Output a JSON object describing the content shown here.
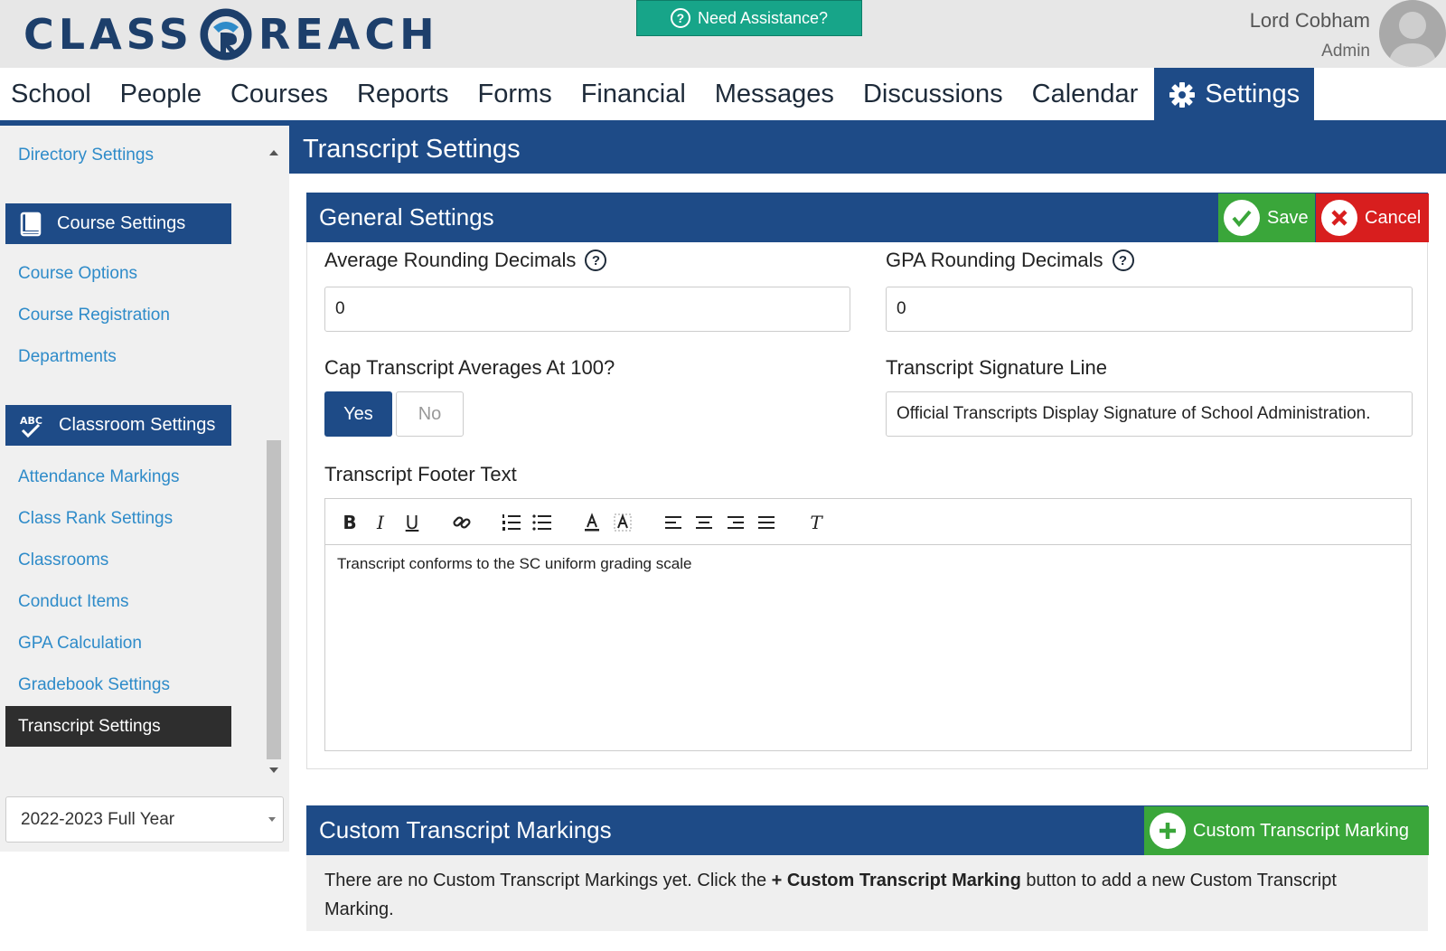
{
  "header": {
    "logo_left": "CLASS",
    "logo_right": "REACH",
    "help_button": "Need Assistance?",
    "user_name": "Lord Cobham",
    "user_role": "Admin"
  },
  "nav": {
    "items": [
      "School",
      "People",
      "Courses",
      "Reports",
      "Forms",
      "Financial",
      "Messages",
      "Discussions",
      "Calendar"
    ],
    "active": "Settings"
  },
  "sidebar": {
    "top_link": "Directory Settings",
    "course_heading": "Course Settings",
    "course_links": [
      "Course Options",
      "Course Registration",
      "Departments"
    ],
    "classroom_heading": "Classroom Settings",
    "classroom_links": [
      "Attendance Markings",
      "Class Rank Settings",
      "Classrooms",
      "Conduct Items",
      "GPA Calculation",
      "Gradebook Settings"
    ],
    "active_link": "Transcript Settings",
    "year_select": "2022-2023 Full Year"
  },
  "page": {
    "title": "Transcript Settings"
  },
  "general": {
    "title": "General Settings",
    "save": "Save",
    "cancel": "Cancel",
    "avg_label": "Average Rounding Decimals",
    "avg_value": "0",
    "gpa_label": "GPA Rounding Decimals",
    "gpa_value": "0",
    "cap_label": "Cap Transcript Averages At 100?",
    "yes": "Yes",
    "no": "No",
    "cap_selected": "Yes",
    "sig_label": "Transcript Signature Line",
    "sig_value": "Official Transcripts Display Signature of School Administration.",
    "footer_label": "Transcript Footer Text",
    "footer_text": "Transcript conforms to the SC uniform grading scale",
    "toolbar": {
      "bold": "B",
      "italic": "I",
      "underline": "U",
      "clear": "T"
    }
  },
  "custom": {
    "title": "Custom Transcript Markings",
    "add_button": "Custom Transcript Marking",
    "empty_before": "There are no Custom Transcript Markings yet. Click the ",
    "empty_bold": "+ Custom Transcript Marking",
    "empty_after": " button to add a new Custom Transcript Marking."
  },
  "colors": {
    "primary": "#1e4b87",
    "success": "#3aa63a",
    "danger": "#d81e1e",
    "help": "#17a589",
    "link": "#2e8bc9"
  }
}
